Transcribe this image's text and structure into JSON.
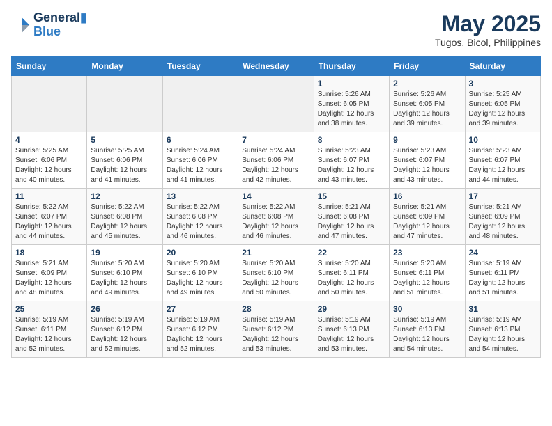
{
  "header": {
    "logo_line1": "General",
    "logo_line2": "Blue",
    "month": "May 2025",
    "location": "Tugos, Bicol, Philippines"
  },
  "weekdays": [
    "Sunday",
    "Monday",
    "Tuesday",
    "Wednesday",
    "Thursday",
    "Friday",
    "Saturday"
  ],
  "weeks": [
    [
      {
        "day": "",
        "info": ""
      },
      {
        "day": "",
        "info": ""
      },
      {
        "day": "",
        "info": ""
      },
      {
        "day": "",
        "info": ""
      },
      {
        "day": "1",
        "info": "Sunrise: 5:26 AM\nSunset: 6:05 PM\nDaylight: 12 hours\nand 38 minutes."
      },
      {
        "day": "2",
        "info": "Sunrise: 5:26 AM\nSunset: 6:05 PM\nDaylight: 12 hours\nand 39 minutes."
      },
      {
        "day": "3",
        "info": "Sunrise: 5:25 AM\nSunset: 6:05 PM\nDaylight: 12 hours\nand 39 minutes."
      }
    ],
    [
      {
        "day": "4",
        "info": "Sunrise: 5:25 AM\nSunset: 6:06 PM\nDaylight: 12 hours\nand 40 minutes."
      },
      {
        "day": "5",
        "info": "Sunrise: 5:25 AM\nSunset: 6:06 PM\nDaylight: 12 hours\nand 41 minutes."
      },
      {
        "day": "6",
        "info": "Sunrise: 5:24 AM\nSunset: 6:06 PM\nDaylight: 12 hours\nand 41 minutes."
      },
      {
        "day": "7",
        "info": "Sunrise: 5:24 AM\nSunset: 6:06 PM\nDaylight: 12 hours\nand 42 minutes."
      },
      {
        "day": "8",
        "info": "Sunrise: 5:23 AM\nSunset: 6:07 PM\nDaylight: 12 hours\nand 43 minutes."
      },
      {
        "day": "9",
        "info": "Sunrise: 5:23 AM\nSunset: 6:07 PM\nDaylight: 12 hours\nand 43 minutes."
      },
      {
        "day": "10",
        "info": "Sunrise: 5:23 AM\nSunset: 6:07 PM\nDaylight: 12 hours\nand 44 minutes."
      }
    ],
    [
      {
        "day": "11",
        "info": "Sunrise: 5:22 AM\nSunset: 6:07 PM\nDaylight: 12 hours\nand 44 minutes."
      },
      {
        "day": "12",
        "info": "Sunrise: 5:22 AM\nSunset: 6:08 PM\nDaylight: 12 hours\nand 45 minutes."
      },
      {
        "day": "13",
        "info": "Sunrise: 5:22 AM\nSunset: 6:08 PM\nDaylight: 12 hours\nand 46 minutes."
      },
      {
        "day": "14",
        "info": "Sunrise: 5:22 AM\nSunset: 6:08 PM\nDaylight: 12 hours\nand 46 minutes."
      },
      {
        "day": "15",
        "info": "Sunrise: 5:21 AM\nSunset: 6:08 PM\nDaylight: 12 hours\nand 47 minutes."
      },
      {
        "day": "16",
        "info": "Sunrise: 5:21 AM\nSunset: 6:09 PM\nDaylight: 12 hours\nand 47 minutes."
      },
      {
        "day": "17",
        "info": "Sunrise: 5:21 AM\nSunset: 6:09 PM\nDaylight: 12 hours\nand 48 minutes."
      }
    ],
    [
      {
        "day": "18",
        "info": "Sunrise: 5:21 AM\nSunset: 6:09 PM\nDaylight: 12 hours\nand 48 minutes."
      },
      {
        "day": "19",
        "info": "Sunrise: 5:20 AM\nSunset: 6:10 PM\nDaylight: 12 hours\nand 49 minutes."
      },
      {
        "day": "20",
        "info": "Sunrise: 5:20 AM\nSunset: 6:10 PM\nDaylight: 12 hours\nand 49 minutes."
      },
      {
        "day": "21",
        "info": "Sunrise: 5:20 AM\nSunset: 6:10 PM\nDaylight: 12 hours\nand 50 minutes."
      },
      {
        "day": "22",
        "info": "Sunrise: 5:20 AM\nSunset: 6:11 PM\nDaylight: 12 hours\nand 50 minutes."
      },
      {
        "day": "23",
        "info": "Sunrise: 5:20 AM\nSunset: 6:11 PM\nDaylight: 12 hours\nand 51 minutes."
      },
      {
        "day": "24",
        "info": "Sunrise: 5:19 AM\nSunset: 6:11 PM\nDaylight: 12 hours\nand 51 minutes."
      }
    ],
    [
      {
        "day": "25",
        "info": "Sunrise: 5:19 AM\nSunset: 6:11 PM\nDaylight: 12 hours\nand 52 minutes."
      },
      {
        "day": "26",
        "info": "Sunrise: 5:19 AM\nSunset: 6:12 PM\nDaylight: 12 hours\nand 52 minutes."
      },
      {
        "day": "27",
        "info": "Sunrise: 5:19 AM\nSunset: 6:12 PM\nDaylight: 12 hours\nand 52 minutes."
      },
      {
        "day": "28",
        "info": "Sunrise: 5:19 AM\nSunset: 6:12 PM\nDaylight: 12 hours\nand 53 minutes."
      },
      {
        "day": "29",
        "info": "Sunrise: 5:19 AM\nSunset: 6:13 PM\nDaylight: 12 hours\nand 53 minutes."
      },
      {
        "day": "30",
        "info": "Sunrise: 5:19 AM\nSunset: 6:13 PM\nDaylight: 12 hours\nand 54 minutes."
      },
      {
        "day": "31",
        "info": "Sunrise: 5:19 AM\nSunset: 6:13 PM\nDaylight: 12 hours\nand 54 minutes."
      }
    ]
  ]
}
